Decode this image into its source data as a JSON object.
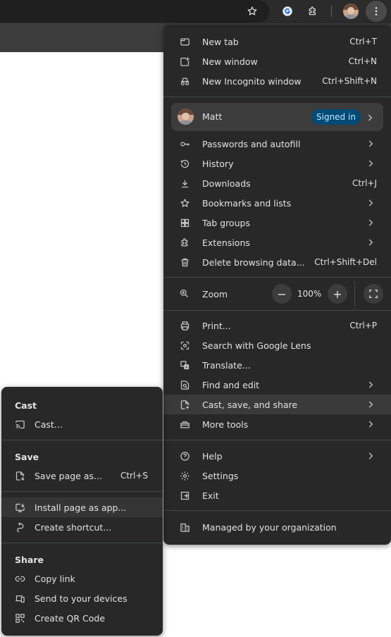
{
  "toolbar": {
    "icons": [
      "star-icon",
      "extension-g-icon",
      "puzzle-icon",
      "profile-avatar",
      "kebab-menu-icon"
    ]
  },
  "main_menu": {
    "new_tab": {
      "label": "New tab",
      "shortcut": "Ctrl+T",
      "icon": "new-tab-icon"
    },
    "new_window": {
      "label": "New window",
      "shortcut": "Ctrl+N",
      "icon": "new-window-icon"
    },
    "incognito": {
      "label": "New Incognito window",
      "shortcut": "Ctrl+Shift+N",
      "icon": "incognito-icon"
    },
    "profile": {
      "name": "Matt",
      "badge": "Signed in"
    },
    "passwords": {
      "label": "Passwords and autofill",
      "icon": "key-icon"
    },
    "history": {
      "label": "History",
      "icon": "history-icon"
    },
    "downloads": {
      "label": "Downloads",
      "shortcut": "Ctrl+J",
      "icon": "download-icon"
    },
    "bookmarks": {
      "label": "Bookmarks and lists",
      "icon": "star-icon"
    },
    "tab_groups": {
      "label": "Tab groups",
      "icon": "tab-groups-icon"
    },
    "extensions": {
      "label": "Extensions",
      "icon": "puzzle-icon"
    },
    "delete_data": {
      "label": "Delete browsing data...",
      "shortcut": "Ctrl+Shift+Del",
      "icon": "trash-icon"
    },
    "zoom": {
      "label": "Zoom",
      "value": "100%",
      "minus": "−",
      "plus": "+"
    },
    "print": {
      "label": "Print...",
      "shortcut": "Ctrl+P",
      "icon": "print-icon"
    },
    "lens": {
      "label": "Search with Google Lens",
      "icon": "lens-icon"
    },
    "translate": {
      "label": "Translate...",
      "icon": "translate-icon"
    },
    "find_edit": {
      "label": "Find and edit",
      "icon": "find-icon"
    },
    "cast_save_share": {
      "label": "Cast, save, and share",
      "icon": "cast-save-icon"
    },
    "more_tools": {
      "label": "More tools",
      "icon": "toolbox-icon"
    },
    "help": {
      "label": "Help",
      "icon": "help-icon"
    },
    "settings": {
      "label": "Settings",
      "icon": "gear-icon"
    },
    "exit": {
      "label": "Exit",
      "icon": "exit-icon"
    },
    "managed": {
      "label": "Managed by your organization",
      "icon": "building-icon"
    }
  },
  "sub_menu": {
    "cast_title": "Cast",
    "cast": {
      "label": "Cast...",
      "icon": "cast-icon"
    },
    "save_title": "Save",
    "save_page": {
      "label": "Save page as...",
      "shortcut": "Ctrl+S",
      "icon": "save-page-icon"
    },
    "install_app": {
      "label": "Install page as app...",
      "icon": "install-app-icon"
    },
    "create_shortcut": {
      "label": "Create shortcut...",
      "icon": "shortcut-icon"
    },
    "share_title": "Share",
    "copy_link": {
      "label": "Copy link",
      "icon": "link-icon"
    },
    "send_devices": {
      "label": "Send to your devices",
      "icon": "devices-icon"
    },
    "qr_code": {
      "label": "Create QR Code",
      "icon": "qr-code-icon"
    }
  },
  "colors": {
    "menu_bg": "#282828",
    "highlight": "#3a3a3a",
    "badge_bg": "#004a77",
    "badge_text": "#c2e7ff"
  }
}
